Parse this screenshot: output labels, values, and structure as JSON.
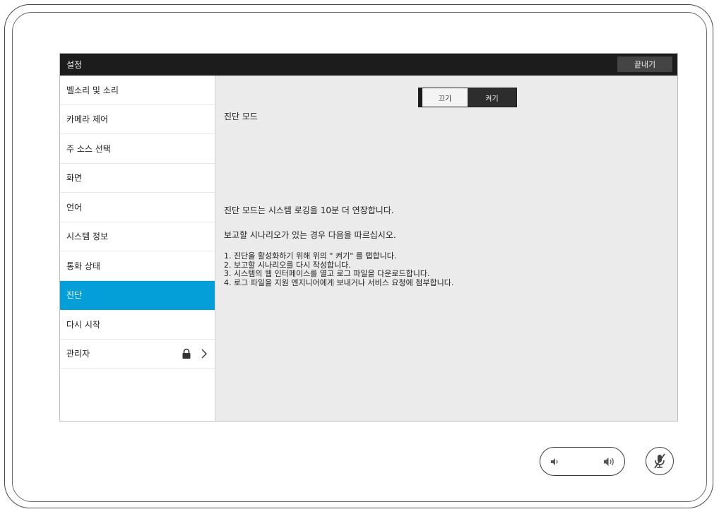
{
  "header": {
    "title": "설정",
    "exit_label": "끝내기"
  },
  "sidebar": {
    "items": [
      {
        "label": "벨소리 및 소리",
        "active": false
      },
      {
        "label": "카메라 제어",
        "active": false
      },
      {
        "label": "주 소스 선택",
        "active": false
      },
      {
        "label": "화면",
        "active": false
      },
      {
        "label": "언어",
        "active": false
      },
      {
        "label": "시스템 정보",
        "active": false
      },
      {
        "label": "통화 상태",
        "active": false
      },
      {
        "label": "진단",
        "active": true
      },
      {
        "label": "다시 시작",
        "active": false
      },
      {
        "label": "관리자",
        "active": false,
        "icons": [
          "lock-icon",
          "chevron-right-icon"
        ]
      }
    ]
  },
  "content": {
    "toggle": {
      "off_label": "끄기",
      "on_label": "켜기",
      "selected": "on"
    },
    "mode_title": "진단 모드",
    "paragraph1": "진단 모드는 시스템 로깅을 10분 더 연장합니다.",
    "paragraph2": "보고할 시나리오가 있는 경우 다음을 따르십시오.",
    "steps": [
      "1. 진단을 활성화하기 위해 위의 \" 켜기\" 를 탭합니다.",
      "2. 보고할 시나리오를 다시 작성합니다.",
      "3. 시스템의 웹 인터페이스를 열고 로그 파일을 다운로드합니다.",
      "4. 로그 파일을 지원 엔지니어에게 보내거나 서비스 요청에 첨부합니다."
    ]
  },
  "controls": {
    "volume_down_icon": "volume-down-icon",
    "volume_up_icon": "volume-up-icon",
    "mute_icon": "microphone-muted-icon"
  },
  "colors": {
    "accent": "#049fd9",
    "titlebar": "#1c1c1c",
    "panel": "#ebebeb"
  }
}
